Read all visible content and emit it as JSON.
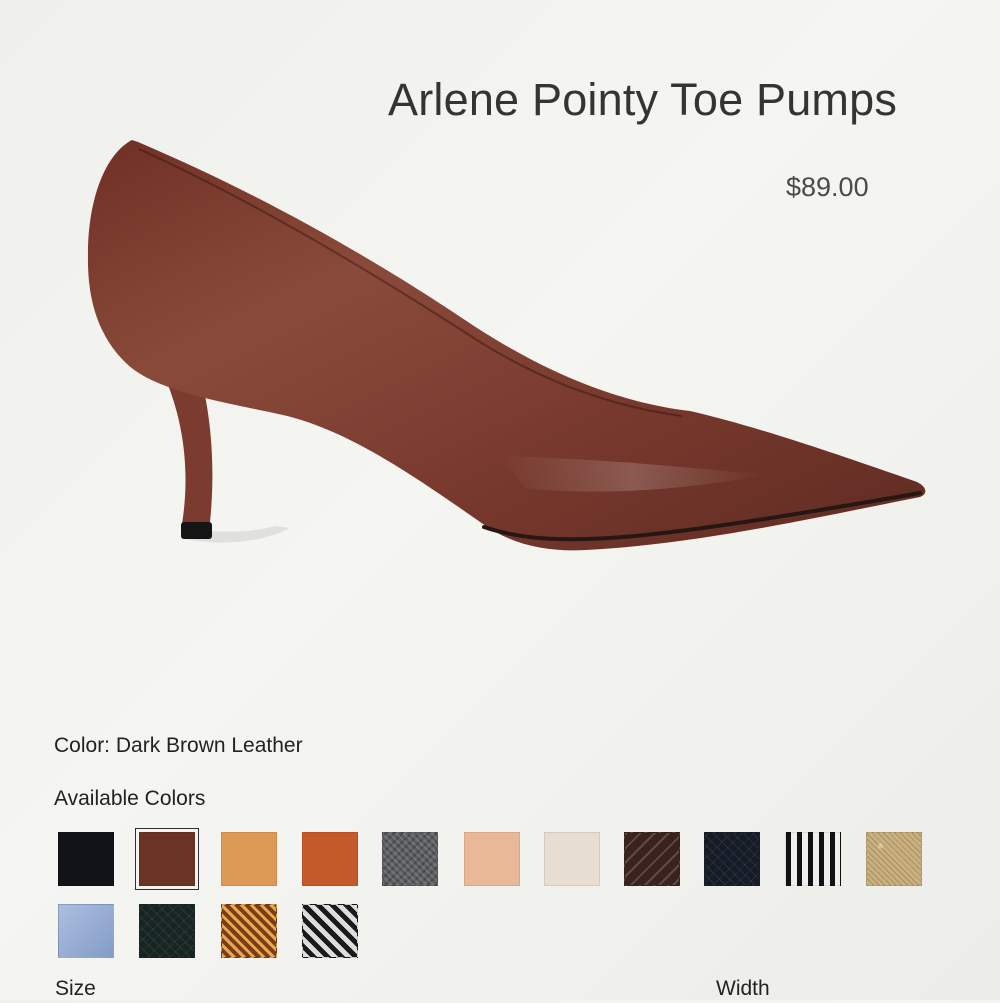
{
  "product": {
    "title": "Arlene Pointy Toe Pumps",
    "price": "$89.00"
  },
  "colors": {
    "selected_label": "Color: Dark Brown Leather",
    "available_title": "Available Colors",
    "swatches": [
      {
        "name": "black-leather",
        "color": "#121318"
      },
      {
        "name": "dark-brown-leather",
        "color": "#6b3326",
        "selected": true
      },
      {
        "name": "tan-leather",
        "color": "#dd9a57"
      },
      {
        "name": "cognac-leather",
        "color": "#c45a2a"
      },
      {
        "name": "black-texture",
        "color": "#5b5e60"
      },
      {
        "name": "blush-leather",
        "color": "#e8b897"
      },
      {
        "name": "cream-leather",
        "color": "#e7ddd0"
      },
      {
        "name": "dark-brown-embossed",
        "color": "#3a221d"
      },
      {
        "name": "navy-embossed",
        "color": "#161c27"
      },
      {
        "name": "black-white-pattern",
        "color": "#d9d9d3"
      },
      {
        "name": "gold-metallic",
        "color": "#c8b07f"
      },
      {
        "name": "light-blue-fabric",
        "color": "#8fa9d6"
      },
      {
        "name": "dark-green-embossed",
        "color": "#172522"
      },
      {
        "name": "gold-brown-pattern",
        "color": "#9c5a25"
      },
      {
        "name": "houndstooth-pattern",
        "color": "#43454a"
      }
    ]
  },
  "size": {
    "label": "Size"
  },
  "width": {
    "label": "Width"
  }
}
